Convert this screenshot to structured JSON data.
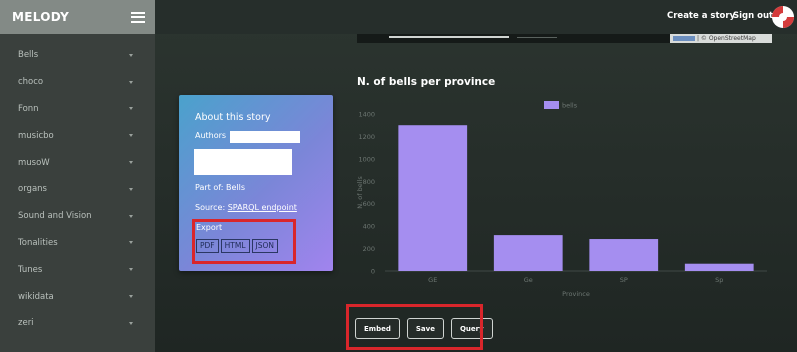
{
  "sidebar": {
    "brand": "MELODY",
    "items": [
      {
        "label": "Bells"
      },
      {
        "label": "choco"
      },
      {
        "label": "Fonn"
      },
      {
        "label": "musicbo"
      },
      {
        "label": "musoW"
      },
      {
        "label": "organs"
      },
      {
        "label": "Sound and Vision"
      },
      {
        "label": "Tonalities"
      },
      {
        "label": "Tunes"
      },
      {
        "label": "wikidata"
      },
      {
        "label": "zeri"
      }
    ]
  },
  "topnav": {
    "create_story": "Create a story",
    "sign_out": "Sign out"
  },
  "map": {
    "attribution": "| © OpenStreetMap"
  },
  "story_card": {
    "title": "About this story",
    "authors_label": "Authors",
    "part_of": "Part of: Bells",
    "source_label": "Source: ",
    "source_link": "SPARQL endpoint",
    "export_label": "Export",
    "export_buttons": [
      "PDF",
      "HTML",
      "JSON"
    ]
  },
  "chart_title": "N. of bells per province",
  "chart_data": {
    "type": "bar",
    "categories": [
      "GE",
      "Ge",
      "SP",
      "Sp"
    ],
    "series": [
      {
        "name": "bells",
        "values": [
          1300,
          320,
          285,
          65
        ]
      }
    ],
    "xlabel": "Province",
    "ylabel": "N. of bells",
    "ylim": [
      0,
      1400
    ],
    "yticks": [
      0,
      200,
      400,
      600,
      800,
      1000,
      1200,
      1400
    ],
    "grid": false,
    "legend": "top-center",
    "bar_color": "#a58ef0"
  },
  "actions": {
    "embed": "Embed",
    "save": "Save",
    "query": "Query"
  },
  "colors": {
    "highlight": "#d9262b",
    "card_gradient_start": "#4aa2cc",
    "card_gradient_end": "#a184ee"
  }
}
